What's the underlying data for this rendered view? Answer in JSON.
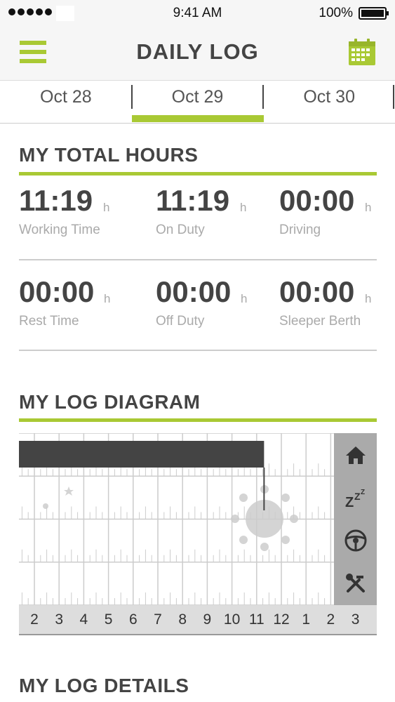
{
  "status_bar": {
    "time": "9:41 AM",
    "battery": "100%"
  },
  "header": {
    "title": "DAILY LOG",
    "menu_icon": "hamburger-menu-icon",
    "calendar_icon": "calendar-icon"
  },
  "date_tabs": [
    {
      "label": "Oct 28",
      "active": false
    },
    {
      "label": "Oct 29",
      "active": true
    },
    {
      "label": "Oct 30",
      "active": false
    }
  ],
  "total_hours": {
    "title": "MY TOTAL HOURS",
    "unit": "h",
    "stats": [
      {
        "value": "11:19",
        "label": "Working Time"
      },
      {
        "value": "11:19",
        "label": "On Duty"
      },
      {
        "value": "00:00",
        "label": "Driving"
      },
      {
        "value": "00:00",
        "label": "Rest Time"
      },
      {
        "value": "00:00",
        "label": "Off Duty"
      },
      {
        "value": "00:00",
        "label": "Sleeper Berth"
      }
    ]
  },
  "log_diagram": {
    "title": "MY LOG DIAGRAM",
    "hour_labels": [
      "2",
      "3",
      "4",
      "5",
      "6",
      "7",
      "8",
      "9",
      "10",
      "11",
      "12",
      "1",
      "2",
      "3"
    ],
    "status_rows": [
      {
        "name": "on-duty",
        "icon": "house-icon"
      },
      {
        "name": "sleeper",
        "icon": "zzz-sleep-icon"
      },
      {
        "name": "driving",
        "icon": "steering-wheel-icon"
      },
      {
        "name": "off-duty",
        "icon": "tools-icon"
      }
    ],
    "on_duty_end_hour": 11.3,
    "colors": {
      "accent": "#a9c934",
      "bar": "#444444",
      "grid": "#cccccc",
      "status_column": "#aaaaaa"
    }
  },
  "log_details": {
    "title": "MY LOG DETAILS"
  }
}
